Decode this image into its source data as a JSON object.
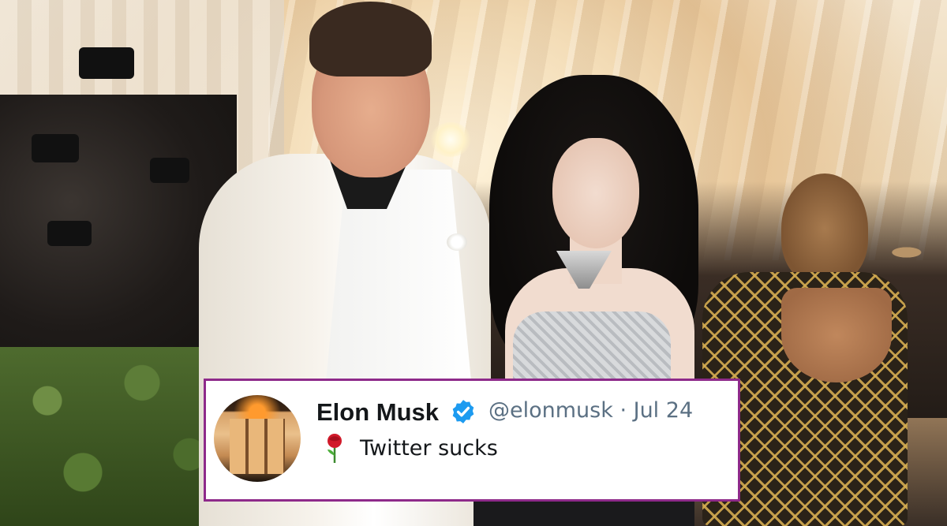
{
  "tweet": {
    "author_name": "Elon Musk",
    "verified": true,
    "meta": "@elonmusk · Jul 24",
    "text": "Twitter sucks",
    "emoji_icon": "rose-icon",
    "border_color": "#8e2a8a",
    "verified_color": "#1d9bf0"
  }
}
